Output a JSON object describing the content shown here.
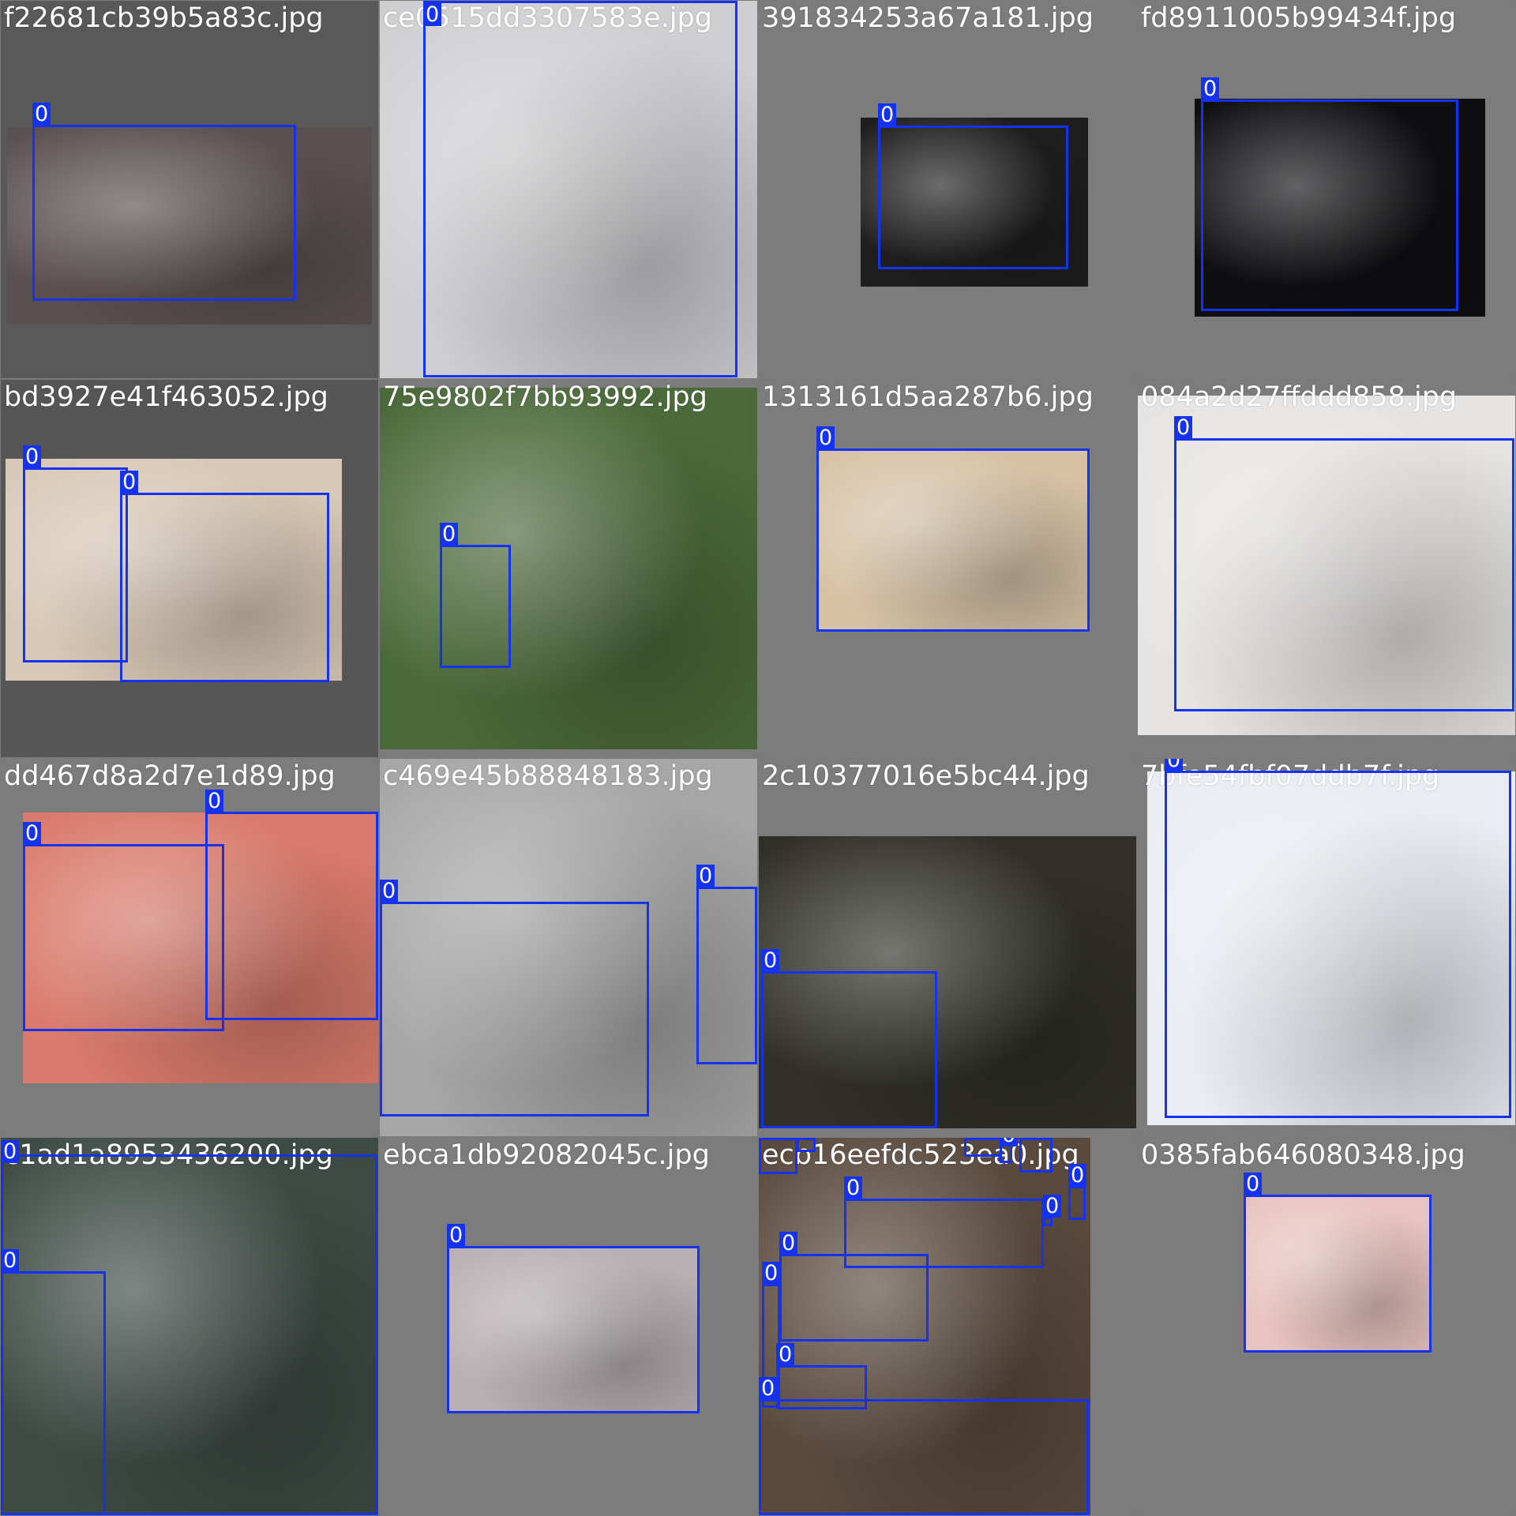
{
  "mosaic": {
    "label_color": "#1432f0",
    "tiles": [
      {
        "filename": "f22681cb39b5a83c.jpg",
        "class_label": "0",
        "box_count": 1,
        "background": "#595959",
        "photo_color": "#5b5050"
      },
      {
        "filename": "ce0515dd3307583e.jpg",
        "class_label": "0",
        "box_count": 1,
        "background": "#6a6a6a",
        "photo_color": "#cfcfd2"
      },
      {
        "filename": "391834253a67a181.jpg",
        "class_label": "0",
        "box_count": 1,
        "background": "#7c7c7c",
        "photo_color": "#1e1e1e"
      },
      {
        "filename": "fd8911005b99434f.jpg",
        "class_label": "0",
        "box_count": 1,
        "background": "#7c7c7c",
        "photo_color": "#0f0f12"
      },
      {
        "filename": "bd3927e41f463052.jpg",
        "class_label": "0",
        "box_count": 2,
        "background": "#565656",
        "photo_color": "#d8c8b6"
      },
      {
        "filename": "75e9802f7bb93992.jpg",
        "class_label": "0",
        "box_count": 1,
        "background": "#7c7c7c",
        "photo_color": "#4b6a3a"
      },
      {
        "filename": "1313161d5aa287b6.jpg",
        "class_label": "0",
        "box_count": 1,
        "background": "#7c7c7c",
        "photo_color": "#d7c2a6"
      },
      {
        "filename": "084a2d27ffddd858.jpg",
        "class_label": "0",
        "box_count": 1,
        "background": "#7c7c7c",
        "photo_color": "#e6e4e2"
      },
      {
        "filename": "dd467d8a2d7e1d89.jpg",
        "class_label": "0",
        "box_count": 2,
        "background": "#7c7c7c",
        "photo_color": "#d97a6c"
      },
      {
        "filename": "c469e45b88848183.jpg",
        "class_label": "0",
        "box_count": 2,
        "background": "#7c7c7c",
        "photo_color": "#a6a6a6"
      },
      {
        "filename": "2c10377016e5bc44.jpg",
        "class_label": "0",
        "box_count": 1,
        "background": "#7c7c7c",
        "photo_color": "#303028"
      },
      {
        "filename": "7bfe54fbf07ddb7f.jpg",
        "class_label": "0",
        "box_count": 1,
        "background": "#7c7c7c",
        "photo_color": "#e9ecf2"
      },
      {
        "filename": "c1ad1a8953436200.jpg",
        "class_label": "0",
        "box_count": 2,
        "background": "#7c7c7c",
        "photo_color": "#3e4a44"
      },
      {
        "filename": "ebca1db92082045c.jpg",
        "class_label": "0",
        "box_count": 1,
        "background": "#7c7c7c",
        "photo_color": "#b8b0b2"
      },
      {
        "filename": "ecb16eefdc523ea0.jpg",
        "class_label": "0",
        "box_count": 12,
        "background": "#7c7c7c",
        "photo_color": "#5a4a3e"
      },
      {
        "filename": "0385fab646080348.jpg",
        "class_label": "0",
        "box_count": 1,
        "background": "#7c7c7c",
        "photo_color": "#e8c4c0"
      }
    ]
  }
}
